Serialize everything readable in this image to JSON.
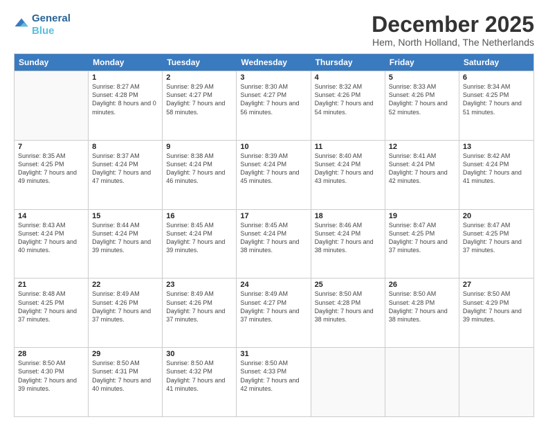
{
  "header": {
    "logo_line1": "General",
    "logo_line2": "Blue",
    "month_title": "December 2025",
    "subtitle": "Hem, North Holland, The Netherlands"
  },
  "weekdays": [
    "Sunday",
    "Monday",
    "Tuesday",
    "Wednesday",
    "Thursday",
    "Friday",
    "Saturday"
  ],
  "weeks": [
    [
      {
        "day": "",
        "sunrise": "",
        "sunset": "",
        "daylight": ""
      },
      {
        "day": "1",
        "sunrise": "Sunrise: 8:27 AM",
        "sunset": "Sunset: 4:28 PM",
        "daylight": "Daylight: 8 hours and 0 minutes."
      },
      {
        "day": "2",
        "sunrise": "Sunrise: 8:29 AM",
        "sunset": "Sunset: 4:27 PM",
        "daylight": "Daylight: 7 hours and 58 minutes."
      },
      {
        "day": "3",
        "sunrise": "Sunrise: 8:30 AM",
        "sunset": "Sunset: 4:27 PM",
        "daylight": "Daylight: 7 hours and 56 minutes."
      },
      {
        "day": "4",
        "sunrise": "Sunrise: 8:32 AM",
        "sunset": "Sunset: 4:26 PM",
        "daylight": "Daylight: 7 hours and 54 minutes."
      },
      {
        "day": "5",
        "sunrise": "Sunrise: 8:33 AM",
        "sunset": "Sunset: 4:26 PM",
        "daylight": "Daylight: 7 hours and 52 minutes."
      },
      {
        "day": "6",
        "sunrise": "Sunrise: 8:34 AM",
        "sunset": "Sunset: 4:25 PM",
        "daylight": "Daylight: 7 hours and 51 minutes."
      }
    ],
    [
      {
        "day": "7",
        "sunrise": "Sunrise: 8:35 AM",
        "sunset": "Sunset: 4:25 PM",
        "daylight": "Daylight: 7 hours and 49 minutes."
      },
      {
        "day": "8",
        "sunrise": "Sunrise: 8:37 AM",
        "sunset": "Sunset: 4:24 PM",
        "daylight": "Daylight: 7 hours and 47 minutes."
      },
      {
        "day": "9",
        "sunrise": "Sunrise: 8:38 AM",
        "sunset": "Sunset: 4:24 PM",
        "daylight": "Daylight: 7 hours and 46 minutes."
      },
      {
        "day": "10",
        "sunrise": "Sunrise: 8:39 AM",
        "sunset": "Sunset: 4:24 PM",
        "daylight": "Daylight: 7 hours and 45 minutes."
      },
      {
        "day": "11",
        "sunrise": "Sunrise: 8:40 AM",
        "sunset": "Sunset: 4:24 PM",
        "daylight": "Daylight: 7 hours and 43 minutes."
      },
      {
        "day": "12",
        "sunrise": "Sunrise: 8:41 AM",
        "sunset": "Sunset: 4:24 PM",
        "daylight": "Daylight: 7 hours and 42 minutes."
      },
      {
        "day": "13",
        "sunrise": "Sunrise: 8:42 AM",
        "sunset": "Sunset: 4:24 PM",
        "daylight": "Daylight: 7 hours and 41 minutes."
      }
    ],
    [
      {
        "day": "14",
        "sunrise": "Sunrise: 8:43 AM",
        "sunset": "Sunset: 4:24 PM",
        "daylight": "Daylight: 7 hours and 40 minutes."
      },
      {
        "day": "15",
        "sunrise": "Sunrise: 8:44 AM",
        "sunset": "Sunset: 4:24 PM",
        "daylight": "Daylight: 7 hours and 39 minutes."
      },
      {
        "day": "16",
        "sunrise": "Sunrise: 8:45 AM",
        "sunset": "Sunset: 4:24 PM",
        "daylight": "Daylight: 7 hours and 39 minutes."
      },
      {
        "day": "17",
        "sunrise": "Sunrise: 8:45 AM",
        "sunset": "Sunset: 4:24 PM",
        "daylight": "Daylight: 7 hours and 38 minutes."
      },
      {
        "day": "18",
        "sunrise": "Sunrise: 8:46 AM",
        "sunset": "Sunset: 4:24 PM",
        "daylight": "Daylight: 7 hours and 38 minutes."
      },
      {
        "day": "19",
        "sunrise": "Sunrise: 8:47 AM",
        "sunset": "Sunset: 4:25 PM",
        "daylight": "Daylight: 7 hours and 37 minutes."
      },
      {
        "day": "20",
        "sunrise": "Sunrise: 8:47 AM",
        "sunset": "Sunset: 4:25 PM",
        "daylight": "Daylight: 7 hours and 37 minutes."
      }
    ],
    [
      {
        "day": "21",
        "sunrise": "Sunrise: 8:48 AM",
        "sunset": "Sunset: 4:25 PM",
        "daylight": "Daylight: 7 hours and 37 minutes."
      },
      {
        "day": "22",
        "sunrise": "Sunrise: 8:49 AM",
        "sunset": "Sunset: 4:26 PM",
        "daylight": "Daylight: 7 hours and 37 minutes."
      },
      {
        "day": "23",
        "sunrise": "Sunrise: 8:49 AM",
        "sunset": "Sunset: 4:26 PM",
        "daylight": "Daylight: 7 hours and 37 minutes."
      },
      {
        "day": "24",
        "sunrise": "Sunrise: 8:49 AM",
        "sunset": "Sunset: 4:27 PM",
        "daylight": "Daylight: 7 hours and 37 minutes."
      },
      {
        "day": "25",
        "sunrise": "Sunrise: 8:50 AM",
        "sunset": "Sunset: 4:28 PM",
        "daylight": "Daylight: 7 hours and 38 minutes."
      },
      {
        "day": "26",
        "sunrise": "Sunrise: 8:50 AM",
        "sunset": "Sunset: 4:28 PM",
        "daylight": "Daylight: 7 hours and 38 minutes."
      },
      {
        "day": "27",
        "sunrise": "Sunrise: 8:50 AM",
        "sunset": "Sunset: 4:29 PM",
        "daylight": "Daylight: 7 hours and 39 minutes."
      }
    ],
    [
      {
        "day": "28",
        "sunrise": "Sunrise: 8:50 AM",
        "sunset": "Sunset: 4:30 PM",
        "daylight": "Daylight: 7 hours and 39 minutes."
      },
      {
        "day": "29",
        "sunrise": "Sunrise: 8:50 AM",
        "sunset": "Sunset: 4:31 PM",
        "daylight": "Daylight: 7 hours and 40 minutes."
      },
      {
        "day": "30",
        "sunrise": "Sunrise: 8:50 AM",
        "sunset": "Sunset: 4:32 PM",
        "daylight": "Daylight: 7 hours and 41 minutes."
      },
      {
        "day": "31",
        "sunrise": "Sunrise: 8:50 AM",
        "sunset": "Sunset: 4:33 PM",
        "daylight": "Daylight: 7 hours and 42 minutes."
      },
      {
        "day": "",
        "sunrise": "",
        "sunset": "",
        "daylight": ""
      },
      {
        "day": "",
        "sunrise": "",
        "sunset": "",
        "daylight": ""
      },
      {
        "day": "",
        "sunrise": "",
        "sunset": "",
        "daylight": ""
      }
    ]
  ]
}
